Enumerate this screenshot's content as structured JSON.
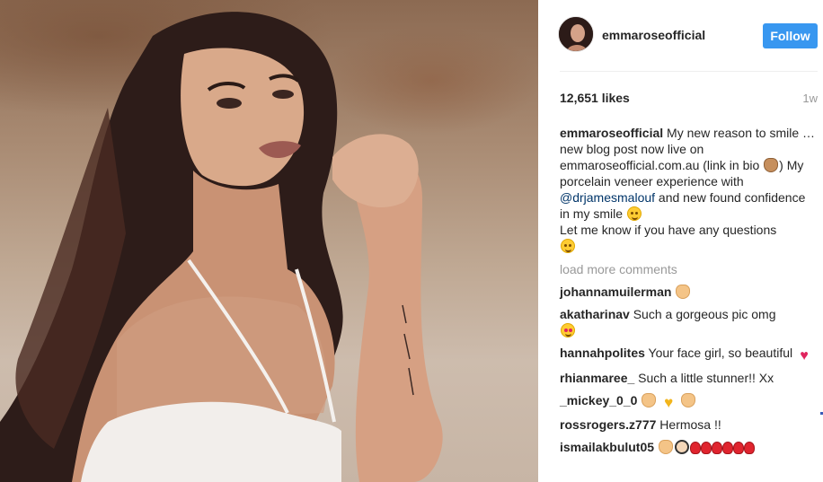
{
  "post": {
    "username": "emmaroseofficial",
    "follow_label": "Follow",
    "likes": "12,651 likes",
    "age": "1w"
  },
  "caption": {
    "username": "emmaroseofficial",
    "text1": " My new reason to smile … new blog post now live on emmaroseofficial.com.au (link in bio ",
    "text2": ") My porcelain veneer experience with ",
    "mention": "@drjamesmalouf",
    "text3": " and new found confidence in my smile ",
    "text4": "Let me know if you have any questions"
  },
  "load_more": "load more comments",
  "comments": [
    {
      "user": "johannamuilerman",
      "text": ""
    },
    {
      "user": "akatharinav",
      "text": "Such a gorgeous pic omg"
    },
    {
      "user": "hannahpolites",
      "text": "Your face girl, so beautiful"
    },
    {
      "user": "rhianmaree_",
      "text": "Such a little stunner!! Xx"
    },
    {
      "user": "_mickey_0_0",
      "text": ""
    },
    {
      "user": "rossrogers.z777",
      "text": "Hermosa !!"
    },
    {
      "user": "ismailakbulut05",
      "text": ""
    }
  ],
  "icons": {
    "avatar": "profile-photo",
    "caption_emoji_1": "pointing-hand-emoji",
    "caption_emoji_2": "winking-kiss-emoji",
    "caption_emoji_3": "winking-tongue-emoji"
  },
  "colors": {
    "follow_button": "#3897f0",
    "mention": "#003569",
    "muted": "#999999"
  }
}
